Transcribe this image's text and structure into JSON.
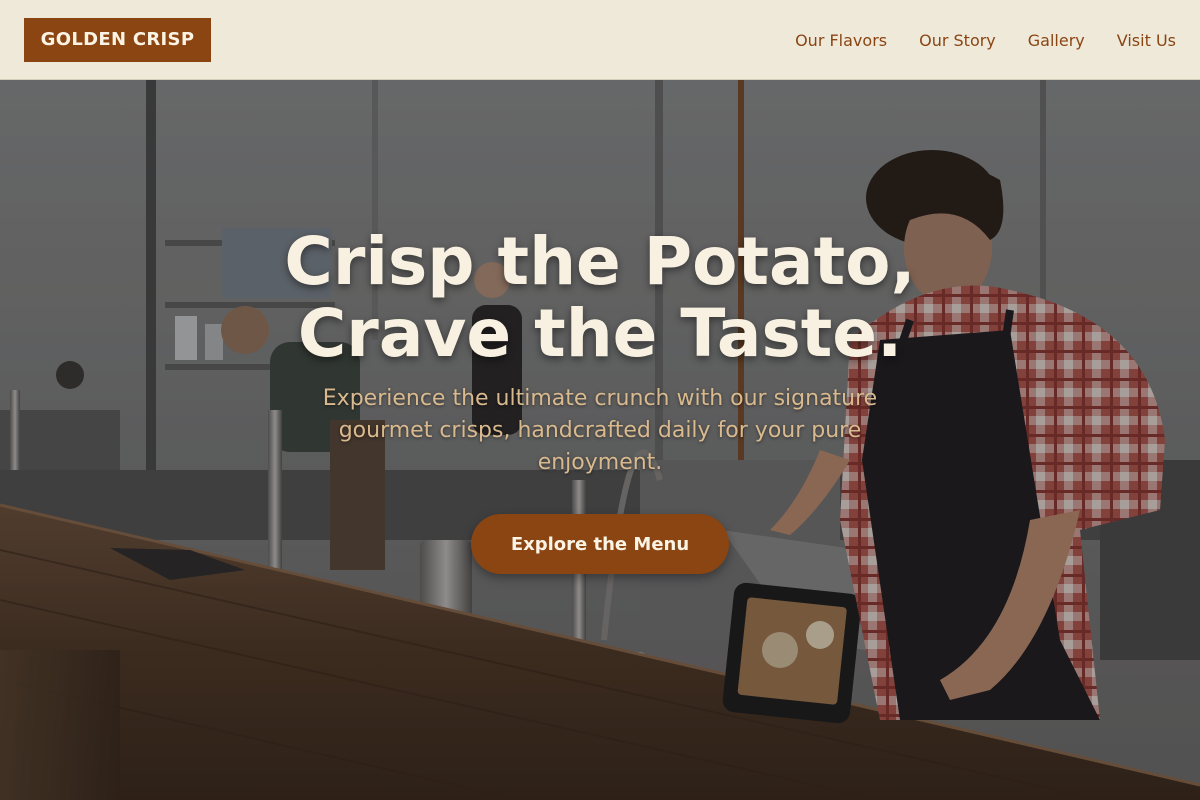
{
  "brand": {
    "logo_text": "GOLDEN CRISP"
  },
  "nav": {
    "links": [
      {
        "label": "Our Flavors"
      },
      {
        "label": "Our Story"
      },
      {
        "label": "Gallery"
      },
      {
        "label": "Visit Us"
      }
    ]
  },
  "hero": {
    "title_line1": "Crisp the Potato,",
    "title_line2": "Crave the Taste.",
    "subtitle": "Experience the ultimate crunch with our signature gourmet crisps, handcrafted daily for your pure enjoyment.",
    "cta_label": "Explore the Menu"
  },
  "colors": {
    "brand_brown": "#8a4513",
    "nav_background": "#efe9da",
    "title_cream": "#f8f0e0",
    "subtitle_tan": "#d9b98e"
  }
}
